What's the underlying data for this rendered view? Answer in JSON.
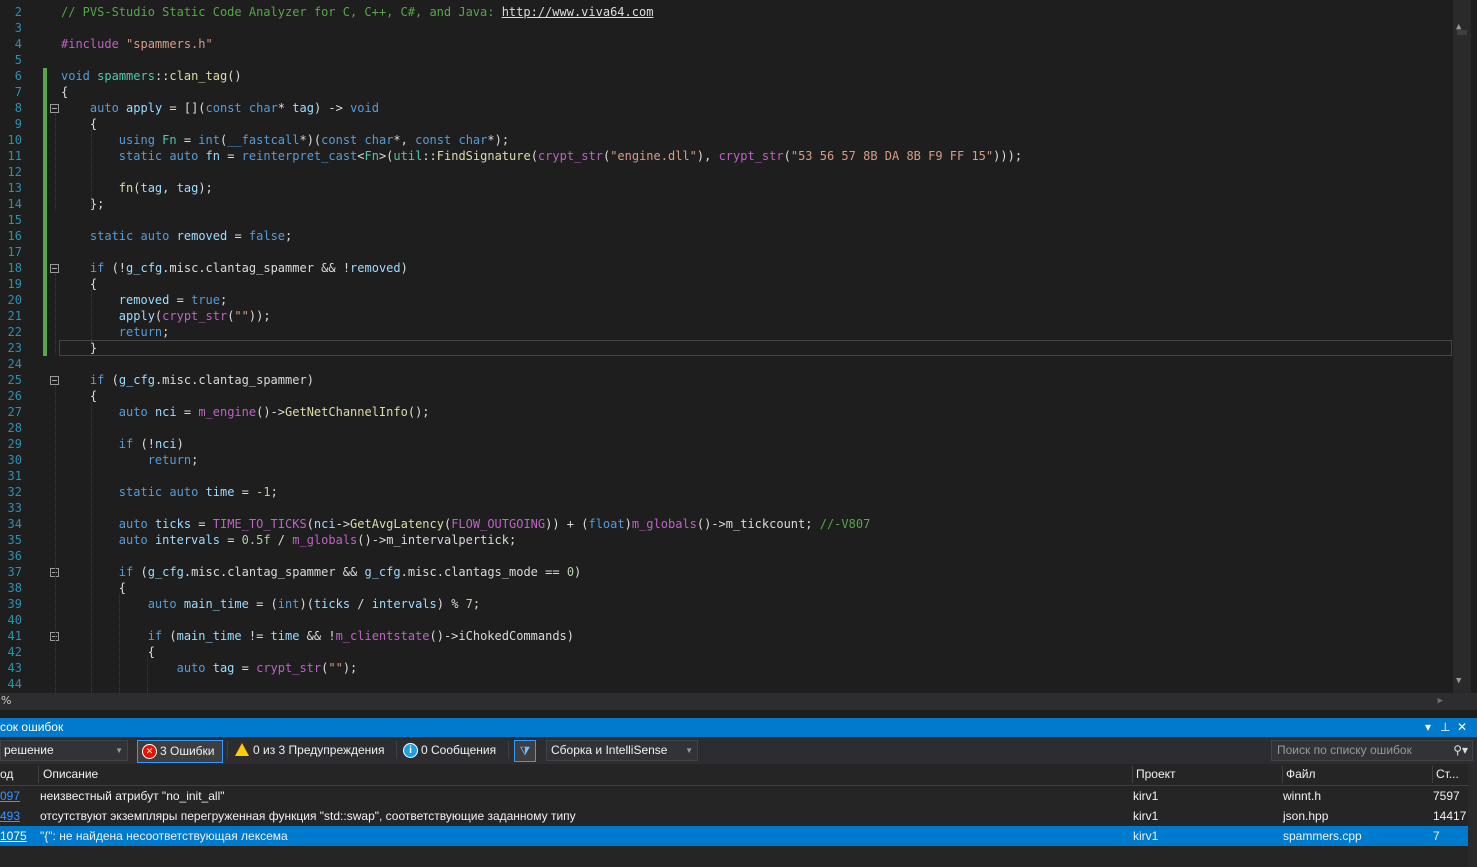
{
  "editor": {
    "lines": [
      {
        "n": "2",
        "html": "<span class=\"cm\">// PVS-Studio Static Code Analyzer for C, C++, C#, and Java: </span><span class=\"link\">http://www.viva64.com</span>"
      },
      {
        "n": "3",
        "html": ""
      },
      {
        "n": "4",
        "html": "<span class=\"mac\">#include</span> <span class=\"str\">\"spammers.h\"</span>"
      },
      {
        "n": "5",
        "html": ""
      },
      {
        "n": "6",
        "html": "<span class=\"kw\">void</span> <span class=\"ty\">spammers</span>::<span class=\"fn\">clan_tag</span>()"
      },
      {
        "n": "7",
        "html": "{"
      },
      {
        "n": "8",
        "html": "    <span class=\"kw\">auto</span> <span class=\"var\">apply</span> = [](<span class=\"kw\">const</span> <span class=\"kw\">char</span>* <span class=\"var\">tag</span>) -> <span class=\"kw\">void</span>"
      },
      {
        "n": "9",
        "html": "    {"
      },
      {
        "n": "10",
        "html": "        <span class=\"kw\">using</span> <span class=\"ty\">Fn</span> = <span class=\"kw\">int</span>(<span class=\"kw\">__fastcall</span>*)(<span class=\"kw\">const</span> <span class=\"kw\">char</span>*, <span class=\"kw\">const</span> <span class=\"kw\">char</span>*);"
      },
      {
        "n": "11",
        "html": "        <span class=\"kw\">static</span> <span class=\"kw\">auto</span> <span class=\"var\">fn</span> = <span class=\"kw\">reinterpret_cast</span>&lt;<span class=\"ty\">Fn</span>&gt;(<span class=\"ty\">util</span>::<span class=\"fn\">FindSignature</span>(<span class=\"mac\">crypt_str</span>(<span class=\"str\">\"engine.dll\"</span>), <span class=\"mac\">crypt_str</span>(<span class=\"str\">\"53 56 57 8B DA 8B F9 FF 15\"</span>)));"
      },
      {
        "n": "12",
        "html": ""
      },
      {
        "n": "13",
        "html": "        <span class=\"fn\">fn</span>(<span class=\"var\">tag</span>, <span class=\"var\">tag</span>);"
      },
      {
        "n": "14",
        "html": "    };"
      },
      {
        "n": "15",
        "html": ""
      },
      {
        "n": "16",
        "html": "    <span class=\"kw\">static</span> <span class=\"kw\">auto</span> <span class=\"var\">removed</span> = <span class=\"kw\">false</span>;"
      },
      {
        "n": "17",
        "html": ""
      },
      {
        "n": "18",
        "html": "    <span class=\"kw\">if</span> (!<span class=\"var\">g_cfg</span>.<span class=\"mem\">misc</span>.<span class=\"mem\">clantag_spammer</span> &amp;&amp; !<span class=\"var\">removed</span>)"
      },
      {
        "n": "19",
        "html": "    {"
      },
      {
        "n": "20",
        "html": "        <span class=\"var\">removed</span> = <span class=\"kw\">true</span>;"
      },
      {
        "n": "21",
        "html": "        <span class=\"var\">apply</span>(<span class=\"mac\">crypt_str</span>(<span class=\"str\">\"\"</span>));"
      },
      {
        "n": "22",
        "html": "        <span class=\"kw\">return</span>;"
      },
      {
        "n": "23",
        "html": "    }"
      },
      {
        "n": "24",
        "html": ""
      },
      {
        "n": "25",
        "html": "    <span class=\"kw\">if</span> (<span class=\"var\">g_cfg</span>.<span class=\"mem\">misc</span>.<span class=\"mem\">clantag_spammer</span>)"
      },
      {
        "n": "26",
        "html": "    {"
      },
      {
        "n": "27",
        "html": "        <span class=\"kw\">auto</span> <span class=\"var\">nci</span> = <span class=\"mac\">m_engine</span>()-><span class=\"fn\">GetNetChannelInfo</span>();"
      },
      {
        "n": "28",
        "html": ""
      },
      {
        "n": "29",
        "html": "        <span class=\"kw\">if</span> (!<span class=\"var\">nci</span>)"
      },
      {
        "n": "30",
        "html": "            <span class=\"kw\">return</span>;"
      },
      {
        "n": "31",
        "html": ""
      },
      {
        "n": "32",
        "html": "        <span class=\"kw\">static</span> <span class=\"kw\">auto</span> <span class=\"var\">time</span> = <span class=\"num\">-1</span>;"
      },
      {
        "n": "33",
        "html": ""
      },
      {
        "n": "34",
        "html": "        <span class=\"kw\">auto</span> <span class=\"var\">ticks</span> = <span class=\"mac\">TIME_TO_TICKS</span>(<span class=\"var\">nci</span>-><span class=\"fn\">GetAvgLatency</span>(<span class=\"mac\">FLOW_OUTGOING</span>)) + (<span class=\"kw\">float</span>)<span class=\"mac\">m_globals</span>()-><span class=\"mem\">m_tickcount</span>; <span class=\"cm\">//-V807</span>"
      },
      {
        "n": "35",
        "html": "        <span class=\"kw\">auto</span> <span class=\"var\">intervals</span> = <span class=\"num\">0.5f</span> / <span class=\"mac\">m_globals</span>()-><span class=\"mem\">m_intervalpertick</span>;"
      },
      {
        "n": "36",
        "html": ""
      },
      {
        "n": "37",
        "html": "        <span class=\"kw\">if</span> (<span class=\"var\">g_cfg</span>.<span class=\"mem\">misc</span>.<span class=\"mem\">clantag_spammer</span> &amp;&amp; <span class=\"var\">g_cfg</span>.<span class=\"mem\">misc</span>.<span class=\"mem\">clantags_mode</span> == <span class=\"num\">0</span>)"
      },
      {
        "n": "38",
        "html": "        {"
      },
      {
        "n": "39",
        "html": "            <span class=\"kw\">auto</span> <span class=\"var\">main_time</span> = (<span class=\"kw\">int</span>)(<span class=\"var\">ticks</span> / <span class=\"var\">intervals</span>) % <span class=\"num\">7</span>;"
      },
      {
        "n": "40",
        "html": ""
      },
      {
        "n": "41",
        "html": "            <span class=\"kw\">if</span> (<span class=\"var\">main_time</span> != <span class=\"var\">time</span> &amp;&amp; !<span class=\"mac\">m_clientstate</span>()-><span class=\"mem\">iChokedCommands</span>)"
      },
      {
        "n": "42",
        "html": "            {"
      },
      {
        "n": "43",
        "html": "                <span class=\"kw\">auto</span> <span class=\"var\">tag</span> = <span class=\"mac\">crypt_str</span>(<span class=\"str\">\"\"</span>);"
      },
      {
        "n": "44",
        "html": ""
      }
    ],
    "zoom": "%"
  },
  "error_list": {
    "title": "сок ошибок",
    "scope": "решение",
    "errors_btn": "3 Ошибки",
    "warnings_btn": "0 из 3 Предупреждения",
    "messages_btn": "0 Сообщения",
    "build_filter": "Сборка и IntelliSense",
    "search_placeholder": "Поиск по списку ошибок",
    "columns": {
      "code": "од",
      "description": "Описание",
      "project": "Проект",
      "file": "Файл",
      "line": "Ст..."
    },
    "rows": [
      {
        "code": "097",
        "description": "неизвестный атрибут \"no_init_all\"",
        "project": "kirv1",
        "file": "winnt.h",
        "line": "7597",
        "selected": false
      },
      {
        "code": "493",
        "description": "отсутствуют экземпляры перегруженная функция \"std::swap\", соответствующие заданному типу",
        "project": "kirv1",
        "file": "json.hpp",
        "line": "14417",
        "selected": false
      },
      {
        "code": "1075",
        "description": "\"{\": не найдена несоответствующая лексема",
        "project": "kirv1",
        "file": "spammers.cpp",
        "line": "7",
        "selected": true
      }
    ]
  },
  "icons": {
    "error": "error-circle-icon",
    "warning": "warning-triangle-icon",
    "info": "info-circle-icon",
    "filter": "filter-icon",
    "search": "search-icon",
    "pin": "pin-icon",
    "close": "close-icon",
    "dropdown": "dropdown-icon"
  }
}
